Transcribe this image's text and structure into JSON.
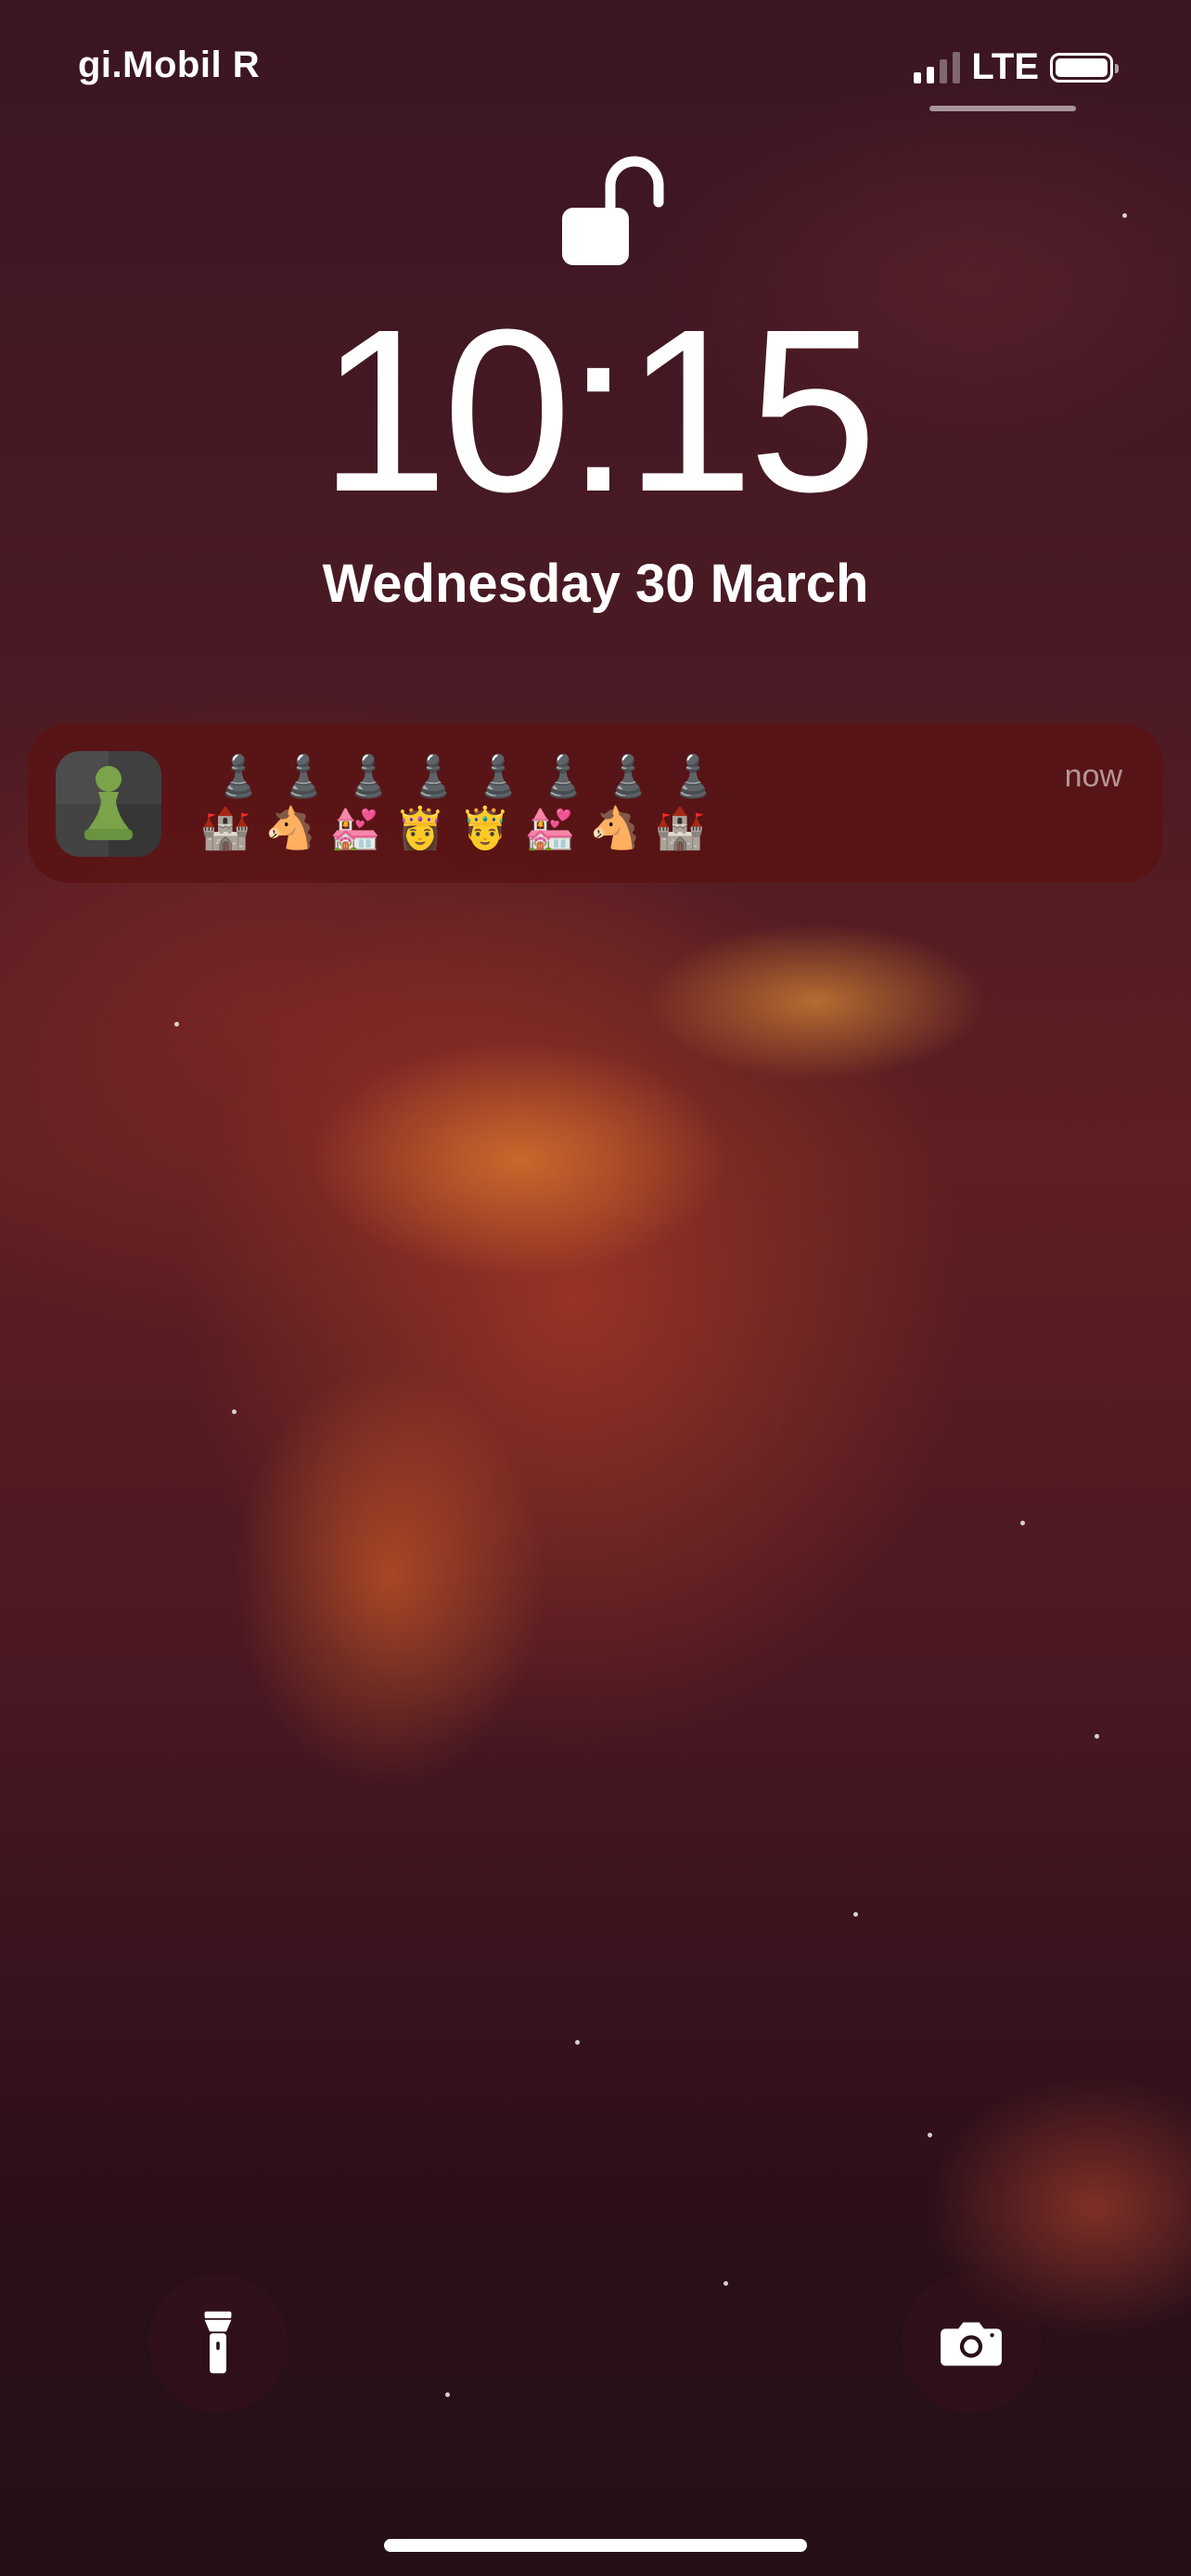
{
  "status_bar": {
    "carrier": "gi.Mobil R",
    "network": "LTE",
    "signal_bars": 4,
    "signal_bars_active": 2,
    "battery_level": 1.0
  },
  "lock_screen": {
    "lock_icon": "unlocked-padlock-icon",
    "time": "10:15",
    "date": "Wednesday 30 March"
  },
  "notification": {
    "app_icon": "chess-pawn-icon",
    "app_icon_color": "#7aa34a",
    "time": "now",
    "line1": [
      "♟️",
      "♟️",
      "♟️",
      "♟️",
      "♟️",
      "♟️",
      "♟️",
      "♟️"
    ],
    "line2": [
      "🏰",
      "🐴",
      "💒",
      "👸",
      "🤴",
      "💒",
      "🐴",
      "🏰"
    ]
  },
  "controls": {
    "left": "flashlight-icon",
    "right": "camera-icon"
  },
  "colors": {
    "notification_bg": "#5a1212",
    "text": "#ffffff"
  }
}
